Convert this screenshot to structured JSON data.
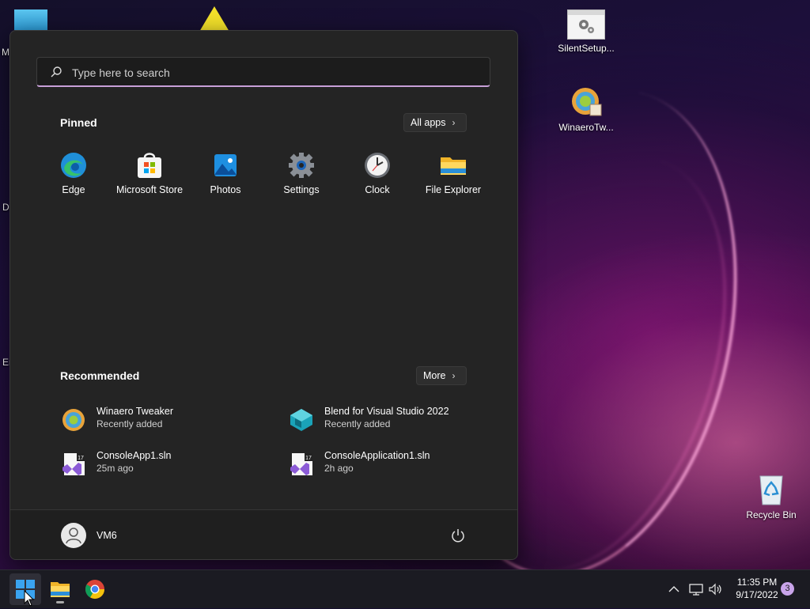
{
  "desktop": {
    "icons": [
      {
        "label": "SilentSetup...",
        "icon": "settings-file-icon"
      },
      {
        "label": "WinaeroTw...",
        "icon": "winaero-tweaker-icon"
      },
      {
        "label": "Recycle Bin",
        "icon": "recycle-bin-icon"
      }
    ],
    "partial_labels": [
      "M",
      "Da",
      "Er"
    ]
  },
  "start_menu": {
    "search": {
      "placeholder": "Type here to search",
      "value": ""
    },
    "pinned": {
      "title": "Pinned",
      "all_apps_label": "All apps",
      "apps": [
        {
          "label": "Edge",
          "icon": "edge-icon"
        },
        {
          "label": "Microsoft Store",
          "icon": "microsoft-store-icon"
        },
        {
          "label": "Photos",
          "icon": "photos-icon"
        },
        {
          "label": "Settings",
          "icon": "settings-gear-icon"
        },
        {
          "label": "Clock",
          "icon": "clock-icon"
        },
        {
          "label": "File Explorer",
          "icon": "folder-icon"
        }
      ]
    },
    "recommended": {
      "title": "Recommended",
      "more_label": "More",
      "items": [
        {
          "name": "Winaero Tweaker",
          "sub": "Recently added",
          "icon": "winaero-tweaker-icon"
        },
        {
          "name": "Blend for Visual Studio 2022",
          "sub": "Recently added",
          "icon": "blend-icon"
        },
        {
          "name": "ConsoleApp1.sln",
          "sub": "25m ago",
          "icon": "vs-solution-icon"
        },
        {
          "name": "ConsoleApplication1.sln",
          "sub": "2h ago",
          "icon": "vs-solution-icon"
        }
      ]
    },
    "user": {
      "name": "VM6"
    }
  },
  "taskbar": {
    "clock": {
      "time": "11:35 PM",
      "date": "9/17/2022"
    },
    "notification_count": "3",
    "vs_badge": "17"
  },
  "colors": {
    "accent": "#c9a4ea",
    "menu_bg": "#242424",
    "taskbar_bg": "#1b1b22"
  }
}
